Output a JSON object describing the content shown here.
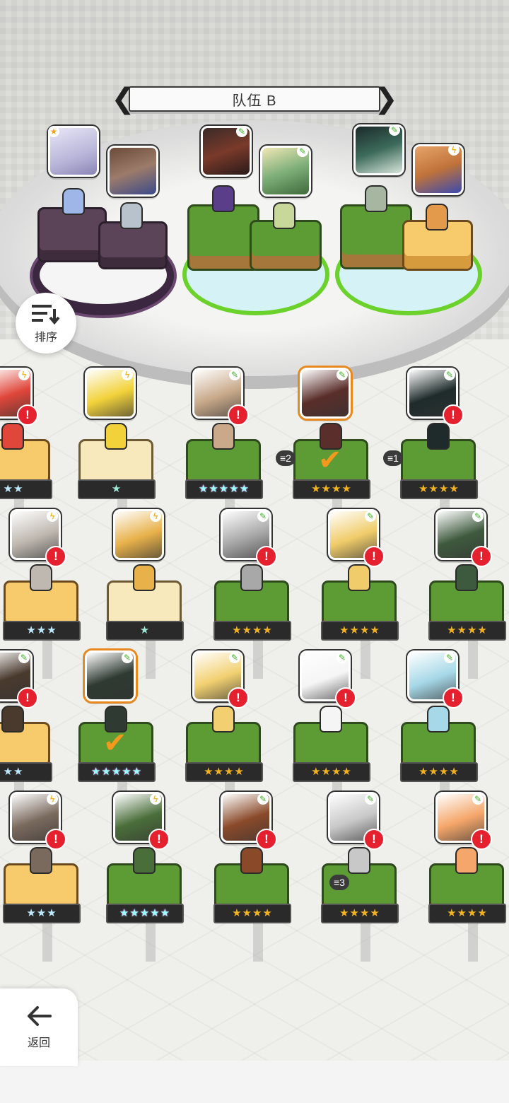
{
  "header": {
    "team_title": "队伍 B",
    "prev_arrow": "❮",
    "next_arrow": "❯"
  },
  "sort_button": {
    "label": "排序"
  },
  "back_button": {
    "label": "返回"
  },
  "warning_mark": "!",
  "check_mark": "✔",
  "copy_badges": {
    "c2": "2",
    "c1": "1",
    "c3": "3"
  },
  "team_slots": [
    {
      "name": "slot-1",
      "ring": "purple"
    },
    {
      "name": "slot-2",
      "ring": "green"
    },
    {
      "name": "slot-3",
      "ring": "green"
    }
  ],
  "roster": {
    "row1": [
      "☆☆",
      "☆",
      "☆☆☆☆☆",
      "☆☆☆☆",
      "☆☆☆☆"
    ],
    "row2": [
      "☆☆☆",
      "☆",
      "☆☆☆☆",
      "☆☆☆☆",
      "☆☆☆☆"
    ],
    "row3": [
      "☆☆",
      "☆☆☆☆☆",
      "☆☆☆☆",
      "☆☆☆☆",
      "☆☆☆☆"
    ],
    "row4": [
      "☆☆☆",
      "☆☆☆☆☆",
      "☆☆☆☆",
      "☆☆☆☆",
      "☆☆☆☆"
    ]
  },
  "colors": {
    "accent_orange": "#f39a1c",
    "warning_red": "#e5212f",
    "grass_green": "#6bd22b"
  }
}
